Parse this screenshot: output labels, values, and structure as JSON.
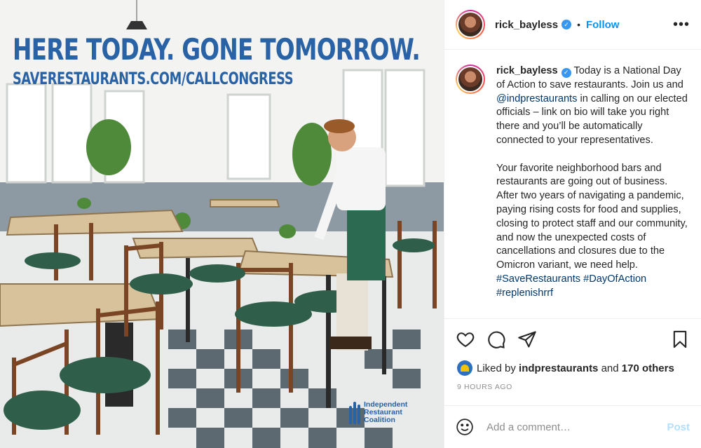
{
  "image": {
    "headline": "HERE TODAY. GONE TOMORROW.",
    "subline": "SAVERESTAURANTS.COM/CALLCONGRESS",
    "logo_lines": [
      "Independent",
      "Restaurant",
      "Coalition"
    ],
    "brand_color": "#2a62a6"
  },
  "header": {
    "username": "rick_bayless",
    "separator": "•",
    "follow_label": "Follow",
    "more_icon": "more-horizontal-icon"
  },
  "caption": {
    "username": "rick_bayless",
    "p1_a": "Today is a National Day of Action to save restaurants. Join us and ",
    "mention": "@indprestaurants",
    "p1_b": " in calling on our elected officials – link on bio will take you right there and you’ll be automatically connected to your representatives.",
    "p2": "Your favorite neighborhood bars and restaurants are going out of business. After two years of navigating a pandemic, paying rising costs for food and supplies, closing to protect staff and our community, and now the unexpected costs of cancellations and closures due to the Omicron variant, we need help. ",
    "hashtag1": "#SaveRestaurants",
    "hashtag2": "#DayOfAction",
    "hashtag3": "#replenishrrf"
  },
  "actions": {
    "icons": [
      "heart-icon",
      "comment-icon",
      "share-icon",
      "bookmark-icon"
    ]
  },
  "likes": {
    "prefix": "Liked by",
    "user": "indprestaurants",
    "and": "and",
    "others": "170 others"
  },
  "timestamp": "9 HOURS AGO",
  "comment": {
    "placeholder": "Add a comment…",
    "post_label": "Post"
  },
  "colors": {
    "link": "#0095f6",
    "verified": "#3897f0",
    "hashtag": "#00376b"
  }
}
